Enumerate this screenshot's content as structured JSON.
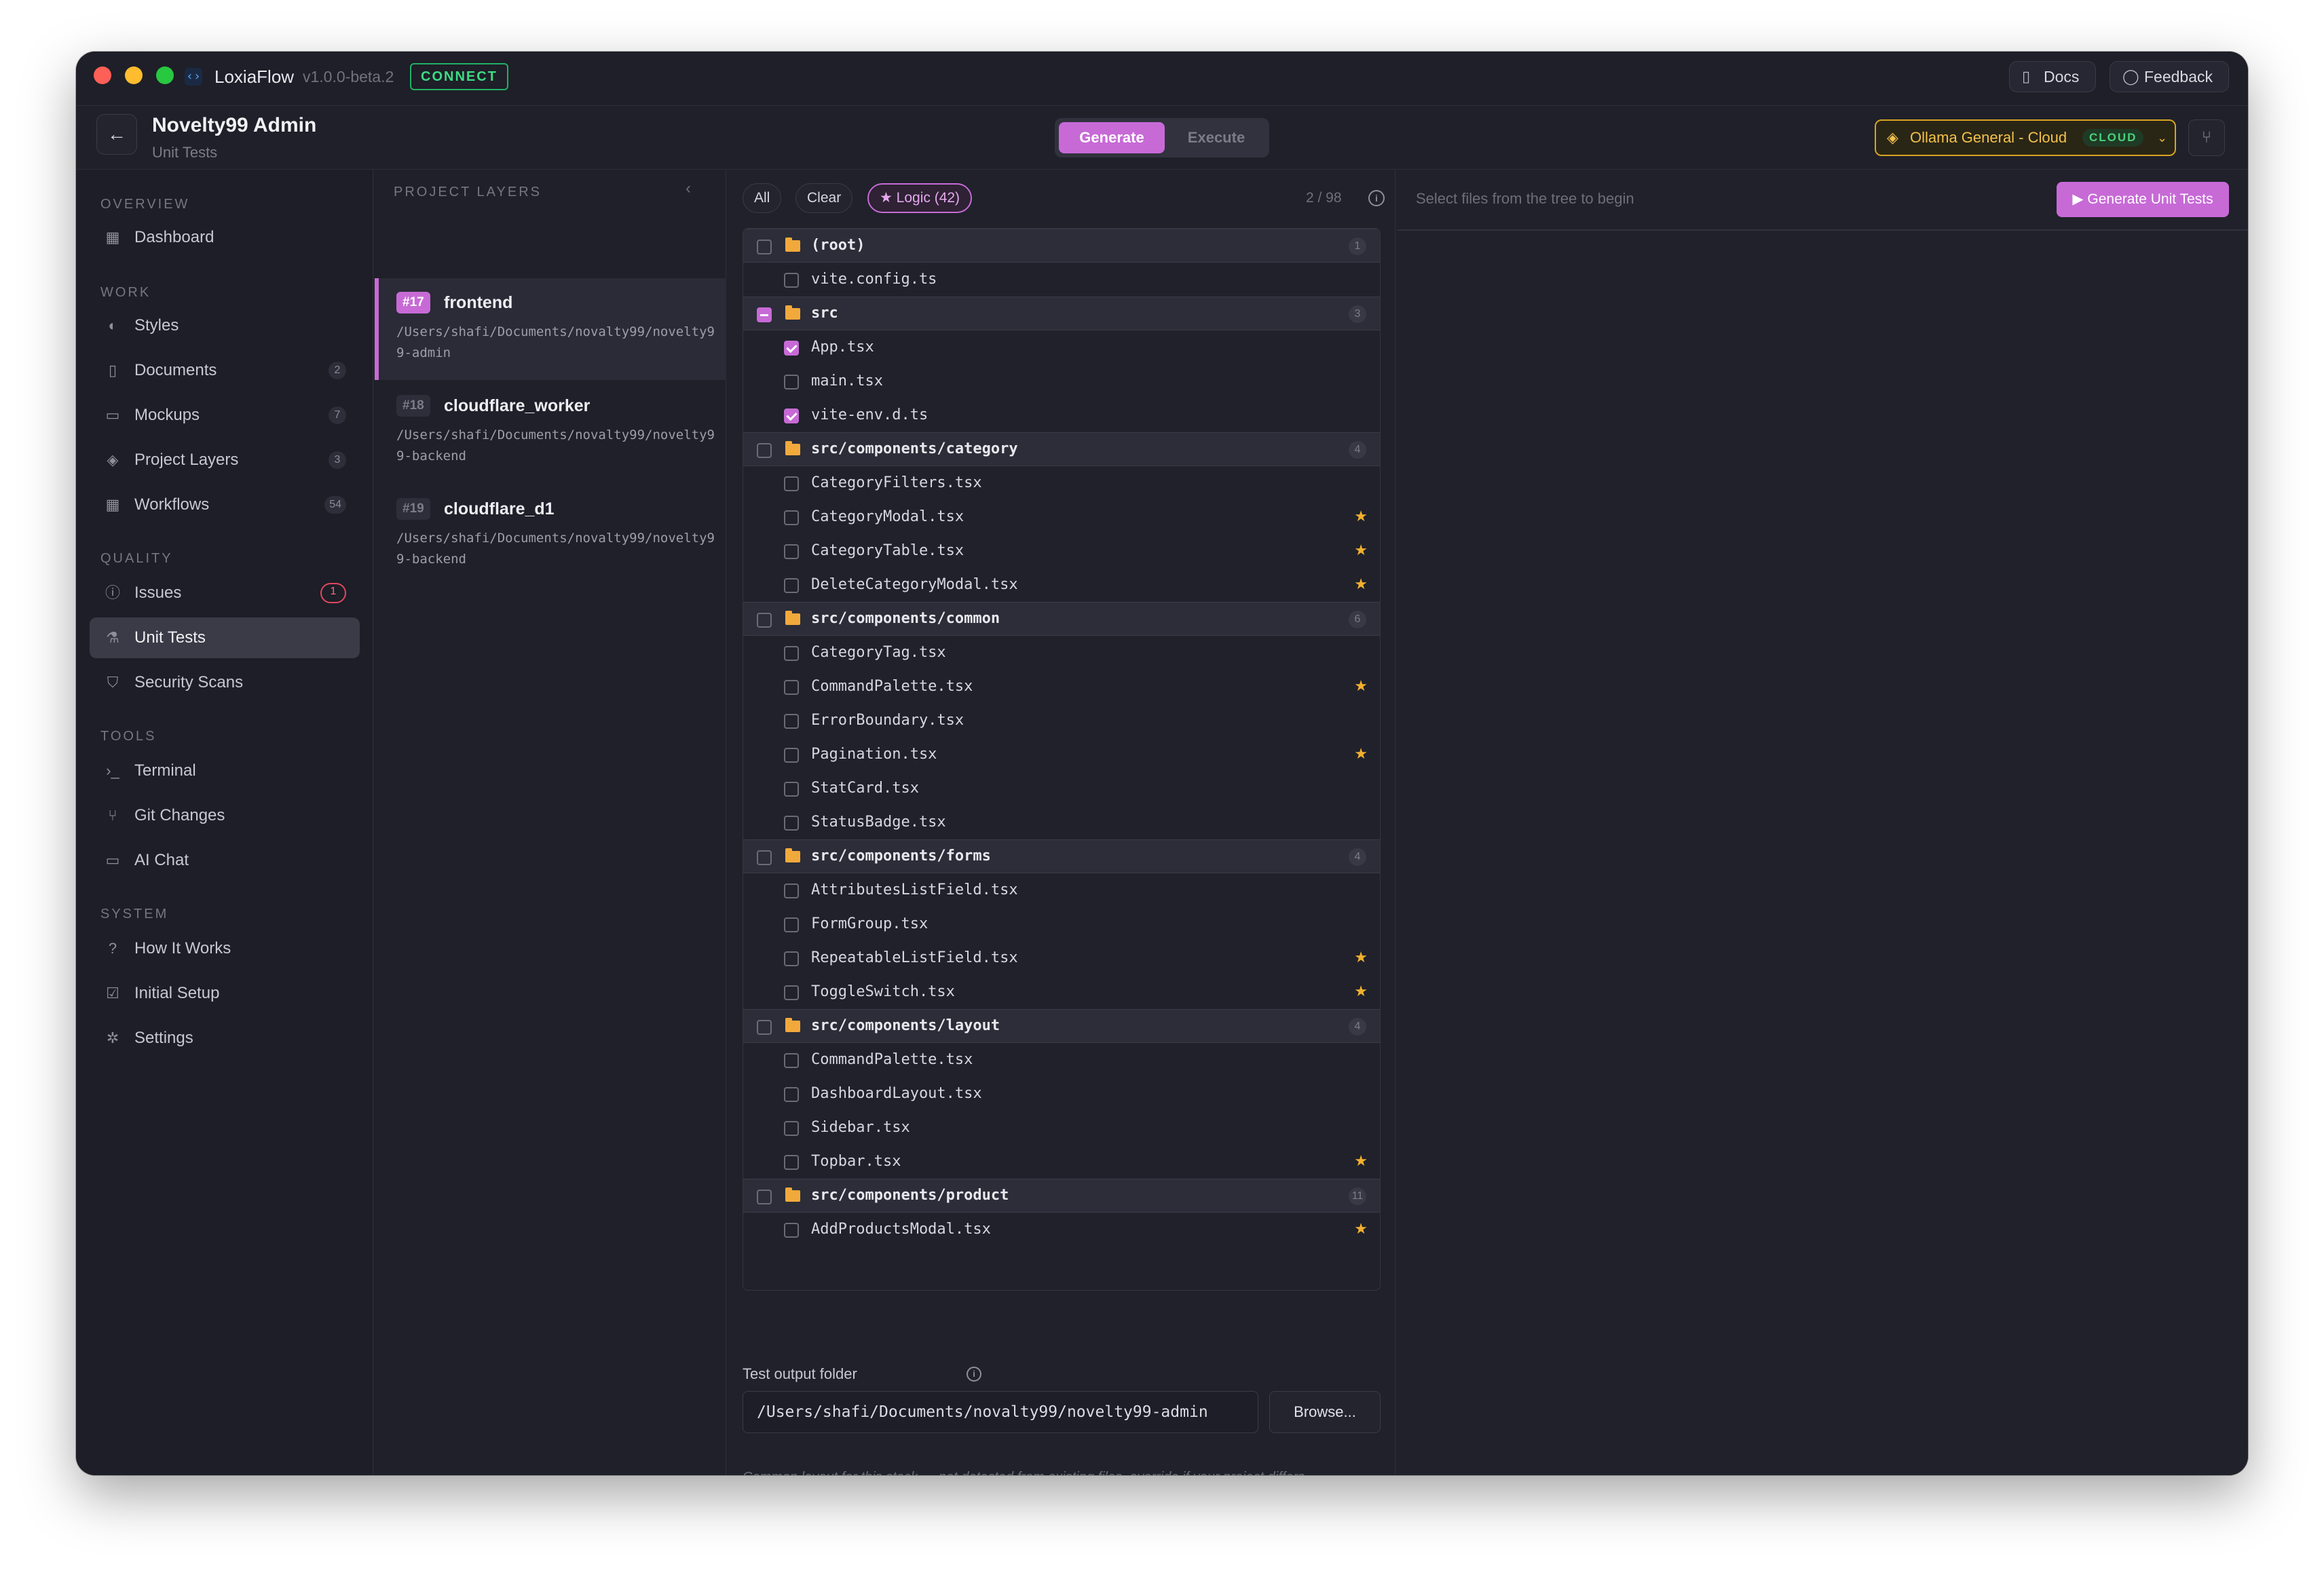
{
  "app": {
    "name": "LoxiaFlow",
    "version": "v1.0.0-beta.2",
    "connect_label": "CONNECT",
    "docs_label": "Docs",
    "feedback_label": "Feedback"
  },
  "header": {
    "title": "Novelty99 Admin",
    "subtitle": "Unit Tests",
    "mode_generate": "Generate",
    "mode_execute": "Execute",
    "model_label": "Ollama General - Cloud",
    "model_badge": "CLOUD"
  },
  "sidebar": {
    "sections": {
      "overview": "OVERVIEW",
      "work": "WORK",
      "quality": "QUALITY",
      "tools": "TOOLS",
      "system": "SYSTEM"
    },
    "items": [
      {
        "label": "Dashboard",
        "icon": "grid-icon",
        "count": ""
      },
      {
        "label": "Styles",
        "icon": "palette-icon",
        "count": ""
      },
      {
        "label": "Documents",
        "icon": "document-icon",
        "count": "2"
      },
      {
        "label": "Mockups",
        "icon": "monitor-icon",
        "count": "7"
      },
      {
        "label": "Project Layers",
        "icon": "layers-icon",
        "count": "3"
      },
      {
        "label": "Workflows",
        "icon": "grid-icon",
        "count": "54"
      },
      {
        "label": "Issues",
        "icon": "alert-circle-icon",
        "count": "1"
      },
      {
        "label": "Unit Tests",
        "icon": "flask-icon",
        "count": ""
      },
      {
        "label": "Security Scans",
        "icon": "shield-icon",
        "count": ""
      },
      {
        "label": "Terminal",
        "icon": "terminal-icon",
        "count": ""
      },
      {
        "label": "Git Changes",
        "icon": "git-branch-icon",
        "count": ""
      },
      {
        "label": "AI Chat",
        "icon": "chat-icon",
        "count": ""
      },
      {
        "label": "How It Works",
        "icon": "help-circle-icon",
        "count": ""
      },
      {
        "label": "Initial Setup",
        "icon": "checkbox-icon",
        "count": ""
      },
      {
        "label": "Settings",
        "icon": "gear-icon",
        "count": ""
      }
    ]
  },
  "layers": {
    "title": "PROJECT LAYERS",
    "items": [
      {
        "tag": "#17",
        "name": "frontend",
        "path": "/Users/shafi/Documents/novalty99/novelty99-admin"
      },
      {
        "tag": "#18",
        "name": "cloudflare_worker",
        "path": "/Users/shafi/Documents/novalty99/novelty99-backend"
      },
      {
        "tag": "#19",
        "name": "cloudflare_d1",
        "path": "/Users/shafi/Documents/novalty99/novelty99-backend"
      }
    ]
  },
  "tree": {
    "chip_all": "All",
    "chip_clear": "Clear",
    "chip_logic": "★ Logic (42)",
    "selected_count": "2 / 98",
    "rows": [
      {
        "type": "folder",
        "name": "(root)",
        "count": "1",
        "state": "none"
      },
      {
        "type": "file",
        "name": "vite.config.ts",
        "checked": false,
        "star": false
      },
      {
        "type": "folder",
        "name": "src",
        "count": "3",
        "state": "partial"
      },
      {
        "type": "file",
        "name": "App.tsx",
        "checked": true,
        "star": false
      },
      {
        "type": "file",
        "name": "main.tsx",
        "checked": false,
        "star": false
      },
      {
        "type": "file",
        "name": "vite-env.d.ts",
        "checked": true,
        "star": false
      },
      {
        "type": "folder",
        "name": "src/components/category",
        "count": "4",
        "state": "none"
      },
      {
        "type": "file",
        "name": "CategoryFilters.tsx",
        "checked": false,
        "star": false
      },
      {
        "type": "file",
        "name": "CategoryModal.tsx",
        "checked": false,
        "star": true
      },
      {
        "type": "file",
        "name": "CategoryTable.tsx",
        "checked": false,
        "star": true
      },
      {
        "type": "file",
        "name": "DeleteCategoryModal.tsx",
        "checked": false,
        "star": true
      },
      {
        "type": "folder",
        "name": "src/components/common",
        "count": "6",
        "state": "none"
      },
      {
        "type": "file",
        "name": "CategoryTag.tsx",
        "checked": false,
        "star": false
      },
      {
        "type": "file",
        "name": "CommandPalette.tsx",
        "checked": false,
        "star": true
      },
      {
        "type": "file",
        "name": "ErrorBoundary.tsx",
        "checked": false,
        "star": false
      },
      {
        "type": "file",
        "name": "Pagination.tsx",
        "checked": false,
        "star": true
      },
      {
        "type": "file",
        "name": "StatCard.tsx",
        "checked": false,
        "star": false
      },
      {
        "type": "file",
        "name": "StatusBadge.tsx",
        "checked": false,
        "star": false
      },
      {
        "type": "folder",
        "name": "src/components/forms",
        "count": "4",
        "state": "none"
      },
      {
        "type": "file",
        "name": "AttributesListField.tsx",
        "checked": false,
        "star": false
      },
      {
        "type": "file",
        "name": "FormGroup.tsx",
        "checked": false,
        "star": false
      },
      {
        "type": "file",
        "name": "RepeatableListField.tsx",
        "checked": false,
        "star": true
      },
      {
        "type": "file",
        "name": "ToggleSwitch.tsx",
        "checked": false,
        "star": true
      },
      {
        "type": "folder",
        "name": "src/components/layout",
        "count": "4",
        "state": "none"
      },
      {
        "type": "file",
        "name": "CommandPalette.tsx",
        "checked": false,
        "star": false
      },
      {
        "type": "file",
        "name": "DashboardLayout.tsx",
        "checked": false,
        "star": false
      },
      {
        "type": "file",
        "name": "Sidebar.tsx",
        "checked": false,
        "star": false
      },
      {
        "type": "file",
        "name": "Topbar.tsx",
        "checked": false,
        "star": true
      },
      {
        "type": "folder",
        "name": "src/components/product",
        "count": "11",
        "state": "none"
      },
      {
        "type": "file",
        "name": "AddProductsModal.tsx",
        "checked": false,
        "star": true
      }
    ],
    "output_label": "Test output folder",
    "output_value": "/Users/shafi/Documents/novalty99/novelty99-admin",
    "browse_label": "Browse...",
    "output_note": "Common layout for this stack — not detected from existing files, override if your project differs."
  },
  "right": {
    "hint": "Select files from the tree to begin",
    "generate_label": "Generate Unit Tests"
  },
  "colors": {
    "accent": "#c76ad6",
    "star": "#f2b02e",
    "folder": "#f2a93b",
    "connect": "#3ddc84",
    "model_border": "#d7a323"
  }
}
